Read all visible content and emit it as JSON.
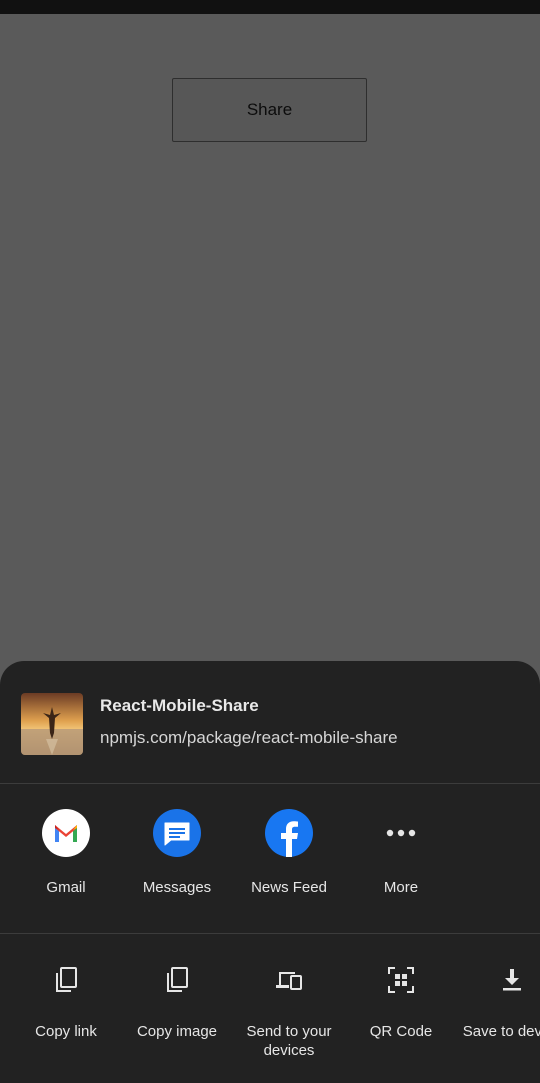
{
  "page": {
    "share_button_label": "Share"
  },
  "share_sheet": {
    "preview": {
      "title": "React-Mobile-Share",
      "url": "npmjs.com/package/react-mobile-share"
    },
    "apps": [
      {
        "label": "Gmail",
        "icon": "gmail-icon"
      },
      {
        "label": "Messages",
        "icon": "messages-icon"
      },
      {
        "label": "News Feed",
        "icon": "facebook-icon"
      },
      {
        "label": "More",
        "icon": "more-icon"
      }
    ],
    "actions": [
      {
        "label": "Copy link",
        "icon": "copy-icon"
      },
      {
        "label": "Copy image",
        "icon": "copy-icon"
      },
      {
        "label": "Send to your devices",
        "icon": "devices-icon"
      },
      {
        "label": "QR Code",
        "icon": "qr-code-icon"
      },
      {
        "label": "Save to device",
        "icon": "download-icon"
      }
    ]
  },
  "colors": {
    "overlay": "#5a5a5a",
    "sheet": "#222222",
    "messages_blue": "#1a73e8",
    "facebook_blue": "#1877f2"
  }
}
